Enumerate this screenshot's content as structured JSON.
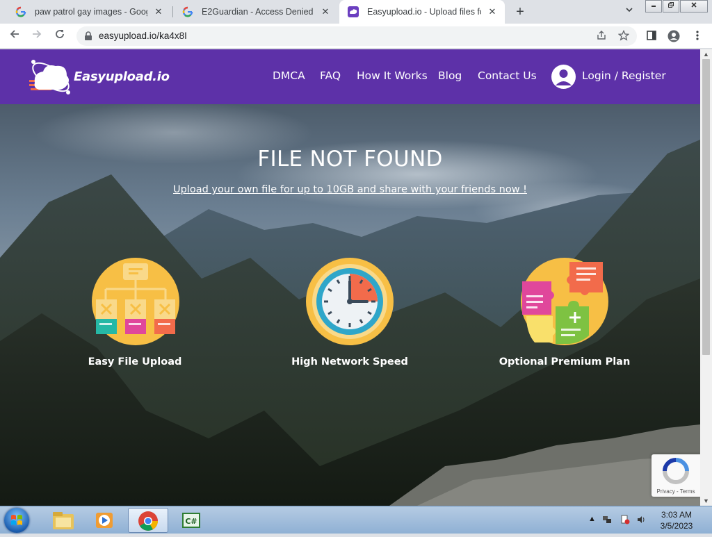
{
  "browser": {
    "tabs": [
      {
        "title": "paw patrol gay images - Google",
        "favicon": "google-icon",
        "active": false
      },
      {
        "title": "E2Guardian - Access Denied",
        "favicon": "google-icon",
        "active": false
      },
      {
        "title": "Easyupload.io - Upload files for fr",
        "favicon": "easyupload-icon",
        "active": true
      }
    ],
    "close_glyph": "✕",
    "new_tab_glyph": "+",
    "url": "easyupload.io/ka4x8I"
  },
  "site": {
    "brand": "Easyupload.io",
    "nav": [
      "DMCA",
      "FAQ",
      "How It Works",
      "Blog",
      "Contact Us"
    ],
    "login": "Login / Register",
    "colors": {
      "header": "#5d31a8"
    }
  },
  "hero": {
    "title": "FILE NOT FOUND",
    "link": "Upload your own file for up to 10GB and share with your friends now !"
  },
  "features": [
    {
      "label": "Easy File Upload",
      "icon": "flowchart-icon"
    },
    {
      "label": "High Network Speed",
      "icon": "clock-icon"
    },
    {
      "label": "Optional Premium Plan",
      "icon": "puzzle-icon"
    }
  ],
  "recaptcha": {
    "legal": "Privacy - Terms"
  },
  "taskbar": {
    "apps": [
      "explorer-icon",
      "media-player-icon",
      "chrome-icon",
      "csharp-icon"
    ],
    "clock_time": "3:03 AM",
    "clock_date": "3/5/2023"
  }
}
